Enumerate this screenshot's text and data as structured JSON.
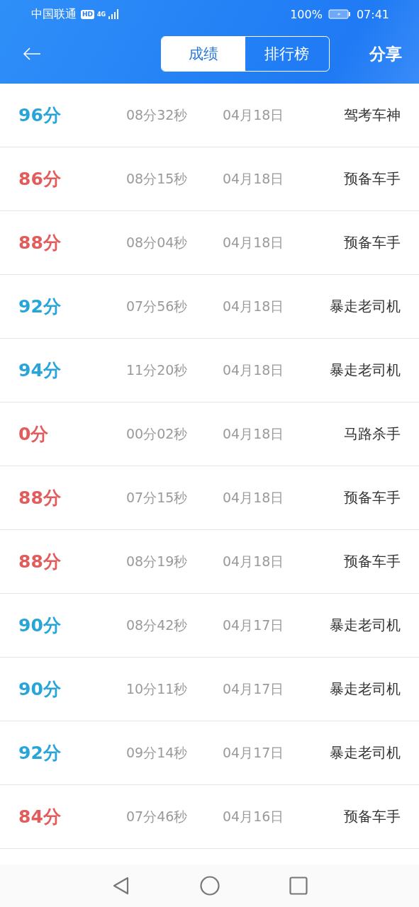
{
  "status_bar": {
    "carrier": "中国联通",
    "hd": "HD",
    "network": "4G",
    "battery": "100%",
    "time": "07:41"
  },
  "header": {
    "tabs": [
      {
        "label": "成绩",
        "selected": true
      },
      {
        "label": "排行榜",
        "selected": false
      }
    ],
    "share": "分享"
  },
  "records": [
    {
      "score": "96分",
      "passed": true,
      "duration": "08分32秒",
      "date": "04月18日",
      "title": "驾考车神"
    },
    {
      "score": "86分",
      "passed": false,
      "duration": "08分15秒",
      "date": "04月18日",
      "title": "预备车手"
    },
    {
      "score": "88分",
      "passed": false,
      "duration": "08分04秒",
      "date": "04月18日",
      "title": "预备车手"
    },
    {
      "score": "92分",
      "passed": true,
      "duration": "07分56秒",
      "date": "04月18日",
      "title": "暴走老司机"
    },
    {
      "score": "94分",
      "passed": true,
      "duration": "11分20秒",
      "date": "04月18日",
      "title": "暴走老司机"
    },
    {
      "score": "0分",
      "passed": false,
      "duration": "00分02秒",
      "date": "04月18日",
      "title": "马路杀手"
    },
    {
      "score": "88分",
      "passed": false,
      "duration": "07分15秒",
      "date": "04月18日",
      "title": "预备车手"
    },
    {
      "score": "88分",
      "passed": false,
      "duration": "08分19秒",
      "date": "04月18日",
      "title": "预备车手"
    },
    {
      "score": "90分",
      "passed": true,
      "duration": "08分42秒",
      "date": "04月17日",
      "title": "暴走老司机"
    },
    {
      "score": "90分",
      "passed": true,
      "duration": "10分11秒",
      "date": "04月17日",
      "title": "暴走老司机"
    },
    {
      "score": "92分",
      "passed": true,
      "duration": "09分14秒",
      "date": "04月17日",
      "title": "暴走老司机"
    },
    {
      "score": "84分",
      "passed": false,
      "duration": "07分46秒",
      "date": "04月16日",
      "title": "预备车手"
    }
  ]
}
